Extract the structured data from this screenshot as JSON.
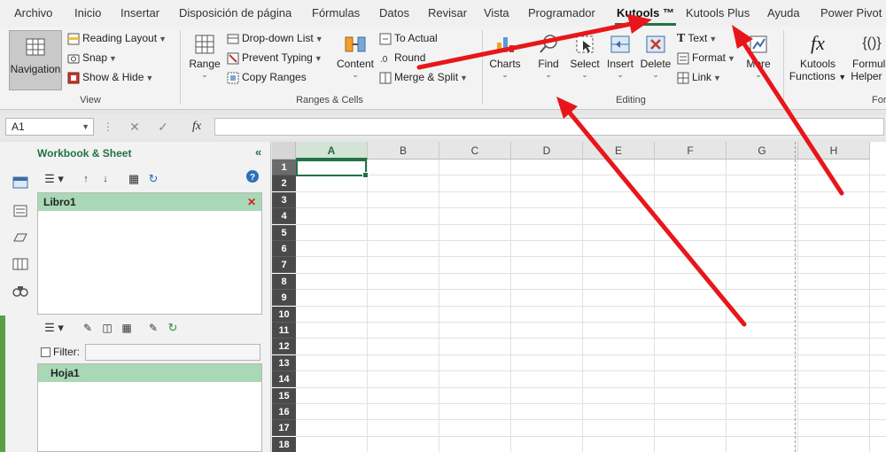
{
  "menu_tabs": [
    {
      "label": "Archivo"
    },
    {
      "label": "Inicio"
    },
    {
      "label": "Insertar"
    },
    {
      "label": "Disposición de página"
    },
    {
      "label": "Fórmulas"
    },
    {
      "label": "Datos"
    },
    {
      "label": "Revisar"
    },
    {
      "label": "Vista"
    },
    {
      "label": "Programador"
    },
    {
      "label": "Kutools ™",
      "active": true
    },
    {
      "label": "Kutools Plus"
    },
    {
      "label": "Ayuda"
    },
    {
      "label": "Power Pivot"
    }
  ],
  "ribbon": {
    "view_group": {
      "label": "View",
      "navigation": "Navigation",
      "reading_layout": "Reading Layout",
      "snap": "Snap",
      "show_hide": "Show & Hide"
    },
    "ranges_group": {
      "label": "Ranges & Cells",
      "range": "Range",
      "drop_down_list": "Drop-down List",
      "prevent_typing": "Prevent Typing",
      "copy_ranges": "Copy Ranges",
      "content": "Content",
      "to_actual": "To Actual",
      "round": "Round",
      "merge_split": "Merge & Split"
    },
    "editing_group": {
      "label": "Editing",
      "charts": "Charts",
      "find": "Find",
      "select": "Select",
      "insert": "Insert",
      "delete": "Delete",
      "text": "Text",
      "format": "Format",
      "link": "Link",
      "more": "More"
    },
    "formulas_group": {
      "label": "For",
      "kutools_functions_1": "Kutools",
      "kutools_functions_2": "Functions",
      "formula_helper_1": "Formula",
      "formula_helper_2": "Helper"
    }
  },
  "formula_bar": {
    "name_box": "A1",
    "value": ""
  },
  "pane": {
    "title": "Workbook & Sheet",
    "collapse": "«",
    "workbook": "Libro1",
    "filter_label": "Filter:",
    "filter_value": "",
    "sheet": "Hoja1"
  },
  "grid": {
    "columns": [
      "A",
      "B",
      "C",
      "D",
      "E",
      "F",
      "G",
      "H"
    ],
    "rows": [
      "1",
      "2",
      "3",
      "4",
      "5",
      "6",
      "7",
      "8",
      "9",
      "10",
      "11",
      "12",
      "13",
      "14",
      "15",
      "16",
      "17",
      "18"
    ],
    "selected_cell": "A1"
  },
  "colors": {
    "accent": "#217346",
    "annotation_arrow": "#e8161b"
  }
}
